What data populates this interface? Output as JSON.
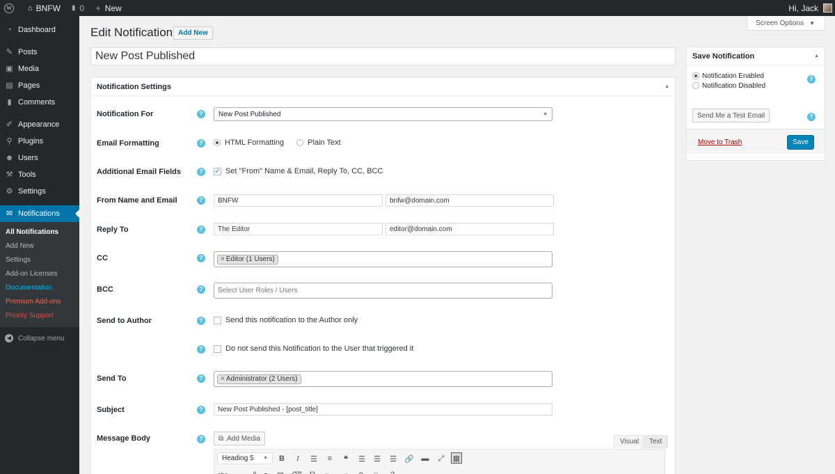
{
  "adminbar": {
    "site_name": "BNFW",
    "comments_count": "0",
    "new_label": "New",
    "greeting": "Hi, Jack"
  },
  "sidebar": {
    "items": [
      {
        "icon": "dashboard-icon",
        "label": "Dashboard"
      },
      {
        "icon": "pin-icon",
        "label": "Posts"
      },
      {
        "icon": "media-icon",
        "label": "Media"
      },
      {
        "icon": "pages-icon",
        "label": "Pages"
      },
      {
        "icon": "comments-icon",
        "label": "Comments"
      },
      {
        "icon": "brush-icon",
        "label": "Appearance"
      },
      {
        "icon": "plugins-icon",
        "label": "Plugins"
      },
      {
        "icon": "users-icon",
        "label": "Users"
      },
      {
        "icon": "wrench-icon",
        "label": "Tools"
      },
      {
        "icon": "settings-icon",
        "label": "Settings"
      },
      {
        "icon": "envelope-icon",
        "label": "Notifications"
      }
    ],
    "submenu": [
      "All Notifications",
      "Add New",
      "Settings",
      "Add-on Licenses",
      "Documentation",
      "Premium Add-ons",
      "Priority Support"
    ],
    "collapse_label": "Collapse menu"
  },
  "header": {
    "screen_options": "Screen Options",
    "title": "Edit Notification",
    "add_new": "Add New"
  },
  "notification_title": "New Post Published",
  "settings": {
    "heading": "Notification Settings",
    "notification_for_label": "Notification For",
    "notification_for_value": "New Post Published",
    "email_formatting_label": "Email Formatting",
    "html_formatting": "HTML Formatting",
    "plain_text": "Plain Text",
    "additional_fields_label": "Additional Email Fields",
    "additional_fields_text": "Set \"From\" Name & Email, Reply To, CC, BCC",
    "from_label": "From Name and Email",
    "from_name": "BNFW",
    "from_email": "bnfw@domain.com",
    "reply_to_label": "Reply To",
    "reply_to_name": "The Editor",
    "reply_to_email": "editor@domain.com",
    "cc_label": "CC",
    "cc_token": "Editor (1 Users)",
    "bcc_label": "BCC",
    "bcc_placeholder": "Select User Roles / Users",
    "send_to_author_label": "Send to Author",
    "send_to_author_text": "Send this notification to the Author only",
    "do_not_send_text": "Do not send this Notification to the User that triggered it",
    "send_to_label": "Send To",
    "send_to_token": "Administrator (2 Users)",
    "subject_label": "Subject",
    "subject_value": "New Post Published - [post_title]",
    "message_body_label": "Message Body",
    "add_media": "Add Media",
    "tab_visual": "Visual",
    "tab_text": "Text",
    "format_select": "Heading 5"
  },
  "save_box": {
    "heading": "Save Notification",
    "enabled": "Notification Enabled",
    "disabled": "Notification Disabled",
    "test_email": "Send Me a Test Email",
    "trash": "Move to Trash",
    "save": "Save"
  },
  "colors": {
    "admin_bar": "#23282d",
    "accent": "#0073aa",
    "help_icon": "#5bc0de",
    "save_button": "#0085ba",
    "trash": "#aa0000"
  }
}
